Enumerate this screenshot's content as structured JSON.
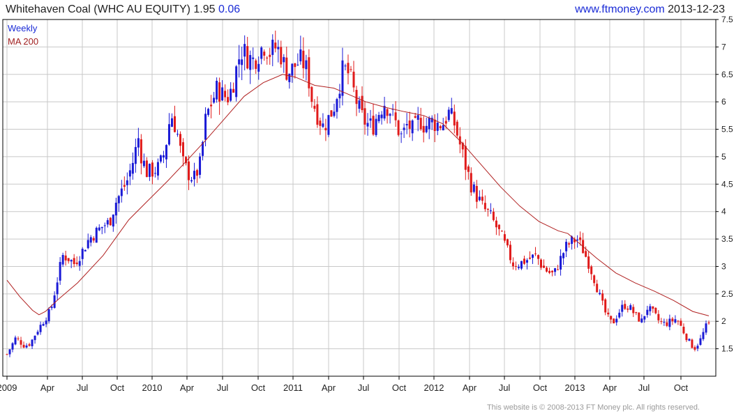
{
  "header": {
    "title": "Whitehaven Coal (WHC AU EQUITY)",
    "price": "1.95",
    "change": "0.06",
    "site": "www.ftmoney.com",
    "date": "2013-12-23"
  },
  "footer": {
    "copyright": "This website is © 2008-2013 FT Money plc. All rights reserved."
  },
  "colors": {
    "up": "#1a1ad6",
    "down": "#e01a1a",
    "ma": "#b02020",
    "grid": "#c8c8c8",
    "axis": "#000000",
    "legend_weekly": "#1a2bd6",
    "legend_ma": "#a02020"
  },
  "chart_data": {
    "type": "candlestick",
    "legend": [
      "Weekly",
      "MA 200"
    ],
    "legend_placement": "top-left",
    "grid": true,
    "x_ticks": [
      "2009",
      "Apr",
      "Jul",
      "Oct",
      "2010",
      "Apr",
      "Jul",
      "Oct",
      "2011",
      "Apr",
      "Jul",
      "Oct",
      "2012",
      "Apr",
      "Jul",
      "Oct",
      "2013",
      "Apr",
      "Jul",
      "Oct"
    ],
    "y_ticks": [
      "1.5",
      "2",
      "2.5",
      "3",
      "3.5",
      "4",
      "4.5",
      "5",
      "5.5",
      "6",
      "6.5",
      "7",
      "7.5"
    ],
    "ylim": [
      1.0,
      7.5
    ],
    "y_axis_side": "right",
    "ma_points": [
      [
        0,
        2.75
      ],
      [
        4,
        2.45
      ],
      [
        8,
        2.2
      ],
      [
        10,
        2.12
      ],
      [
        12,
        2.18
      ],
      [
        16,
        2.4
      ],
      [
        22,
        2.7
      ],
      [
        30,
        3.2
      ],
      [
        38,
        3.85
      ],
      [
        44,
        4.2
      ],
      [
        50,
        4.55
      ],
      [
        56,
        4.92
      ],
      [
        62,
        5.3
      ],
      [
        68,
        5.7
      ],
      [
        74,
        6.1
      ],
      [
        80,
        6.35
      ],
      [
        86,
        6.5
      ],
      [
        90,
        6.45
      ],
      [
        96,
        6.3
      ],
      [
        102,
        6.25
      ],
      [
        106,
        6.15
      ],
      [
        112,
        6.0
      ],
      [
        118,
        5.9
      ],
      [
        124,
        5.82
      ],
      [
        130,
        5.75
      ],
      [
        136,
        5.6
      ],
      [
        142,
        5.25
      ],
      [
        148,
        4.85
      ],
      [
        154,
        4.45
      ],
      [
        160,
        4.1
      ],
      [
        166,
        3.82
      ],
      [
        172,
        3.65
      ],
      [
        175,
        3.6
      ],
      [
        178,
        3.45
      ],
      [
        184,
        3.15
      ],
      [
        190,
        2.88
      ],
      [
        196,
        2.7
      ],
      [
        202,
        2.55
      ],
      [
        208,
        2.38
      ],
      [
        214,
        2.18
      ],
      [
        219,
        2.1
      ]
    ],
    "weekly_close_path": [
      [
        0,
        1.4
      ],
      [
        3,
        1.7
      ],
      [
        6,
        1.55
      ],
      [
        8,
        1.6
      ],
      [
        10,
        1.8
      ],
      [
        13,
        2.05
      ],
      [
        15,
        2.2
      ],
      [
        17,
        2.7
      ],
      [
        19,
        3.2
      ],
      [
        21,
        3.15
      ],
      [
        23,
        3.05
      ],
      [
        26,
        3.3
      ],
      [
        28,
        3.5
      ],
      [
        30,
        3.6
      ],
      [
        33,
        3.75
      ],
      [
        35,
        3.8
      ],
      [
        37,
        4.15
      ],
      [
        39,
        4.35
      ],
      [
        41,
        4.55
      ],
      [
        43,
        4.9
      ],
      [
        45,
        5.35
      ],
      [
        46,
        5.0
      ],
      [
        48,
        4.7
      ],
      [
        50,
        4.75
      ],
      [
        52,
        4.8
      ],
      [
        54,
        5.1
      ],
      [
        56,
        5.8
      ],
      [
        58,
        5.5
      ],
      [
        60,
        4.9
      ],
      [
        62,
        4.7
      ],
      [
        64,
        4.6
      ],
      [
        66,
        4.85
      ],
      [
        68,
        5.7
      ],
      [
        70,
        6.0
      ],
      [
        72,
        6.25
      ],
      [
        74,
        6.1
      ],
      [
        76,
        6.1
      ],
      [
        78,
        6.5
      ],
      [
        80,
        6.95
      ],
      [
        82,
        6.85
      ],
      [
        84,
        6.75
      ],
      [
        86,
        6.9
      ],
      [
        88,
        7.05
      ],
      [
        90,
        6.9
      ],
      [
        92,
        7.0
      ],
      [
        94,
        6.85
      ],
      [
        95,
        6.6
      ],
      [
        97,
        6.55
      ],
      [
        99,
        6.7
      ],
      [
        101,
        6.75
      ],
      [
        103,
        6.5
      ],
      [
        104,
        6.1
      ],
      [
        106,
        5.8
      ],
      [
        108,
        5.55
      ],
      [
        110,
        5.7
      ],
      [
        112,
        5.95
      ],
      [
        113,
        6.2
      ],
      [
        115,
        6.6
      ],
      [
        117,
        6.5
      ],
      [
        119,
        6.1
      ],
      [
        121,
        5.75
      ],
      [
        123,
        5.6
      ],
      [
        125,
        5.55
      ],
      [
        127,
        5.8
      ],
      [
        129,
        6.0
      ],
      [
        131,
        5.85
      ],
      [
        133,
        5.6
      ],
      [
        135,
        5.35
      ],
      [
        137,
        5.6
      ],
      [
        139,
        5.45
      ],
      [
        141,
        5.7
      ],
      [
        143,
        5.55
      ],
      [
        145,
        5.65
      ],
      [
        147,
        5.6
      ],
      [
        149,
        5.6
      ],
      [
        151,
        5.8
      ],
      [
        153,
        5.6
      ],
      [
        155,
        5.2
      ],
      [
        157,
        4.8
      ],
      [
        159,
        4.45
      ],
      [
        161,
        4.25
      ],
      [
        163,
        4.05
      ],
      [
        165,
        3.95
      ],
      [
        167,
        3.75
      ],
      [
        169,
        3.55
      ],
      [
        171,
        3.3
      ],
      [
        173,
        3.05
      ],
      [
        175,
        3.05
      ],
      [
        177,
        3.1
      ],
      [
        179,
        3.15
      ],
      [
        181,
        3.2
      ],
      [
        183,
        3.0
      ],
      [
        185,
        2.9
      ],
      [
        187,
        2.85
      ],
      [
        189,
        3.1
      ],
      [
        191,
        3.35
      ],
      [
        193,
        3.45
      ],
      [
        195,
        3.5
      ],
      [
        197,
        3.3
      ],
      [
        199,
        3.05
      ],
      [
        201,
        2.75
      ],
      [
        203,
        2.4
      ],
      [
        205,
        2.1
      ],
      [
        207,
        1.95
      ],
      [
        209,
        2.15
      ],
      [
        211,
        2.3
      ],
      [
        213,
        2.25
      ],
      [
        215,
        2.1
      ],
      [
        217,
        2.0
      ],
      [
        219,
        2.25
      ],
      [
        221,
        2.15
      ],
      [
        223,
        2.0
      ],
      [
        225,
        1.95
      ],
      [
        227,
        2.0
      ],
      [
        229,
        2.05
      ],
      [
        231,
        1.85
      ],
      [
        233,
        1.65
      ],
      [
        235,
        1.5
      ],
      [
        237,
        1.65
      ],
      [
        239,
        1.9
      ],
      [
        240,
        1.95
      ]
    ]
  }
}
